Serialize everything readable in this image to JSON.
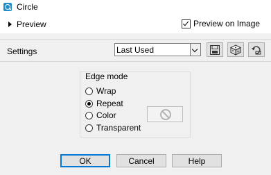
{
  "window": {
    "title": "Circle"
  },
  "preview": {
    "label": "Preview",
    "on_image_label": "Preview on Image",
    "on_image_checked": true
  },
  "settings": {
    "label": "Settings",
    "preset_value": "Last Used"
  },
  "edge_mode": {
    "title": "Edge mode",
    "options": [
      "Wrap",
      "Repeat",
      "Color",
      "Transparent"
    ],
    "selected": "Repeat"
  },
  "buttons": {
    "ok": "OK",
    "cancel": "Cancel",
    "help": "Help"
  },
  "icons": {
    "app": "app-icon",
    "save": "save-preset-icon",
    "random": "randomize-icon",
    "reset": "reset-icon",
    "color": "no-color-icon"
  }
}
